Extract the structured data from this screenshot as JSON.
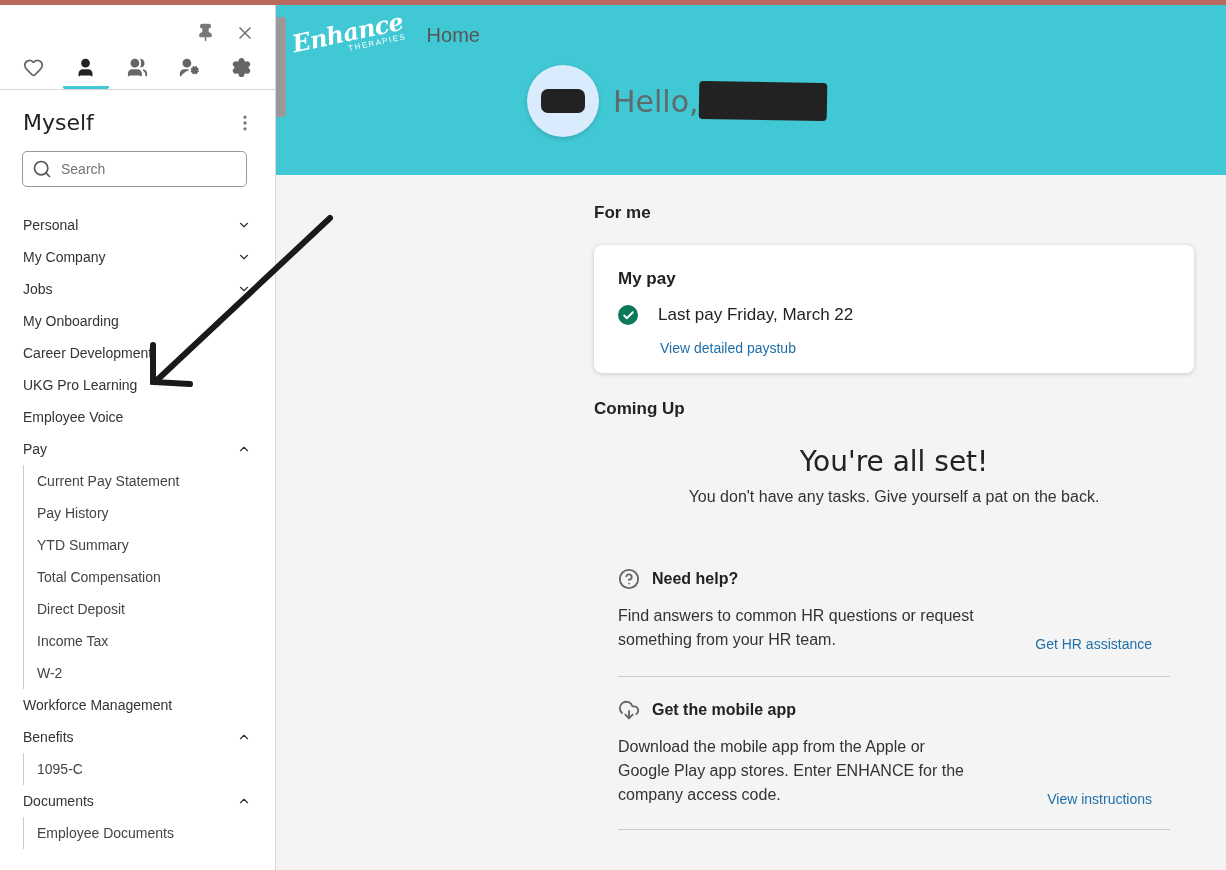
{
  "sidebar": {
    "tabs": [
      {
        "selected": false
      },
      {
        "selected": true
      },
      {
        "selected": false
      },
      {
        "selected": false
      },
      {
        "selected": false
      }
    ],
    "title": "Myself",
    "search": {
      "placeholder": "Search"
    },
    "items": [
      {
        "label": "Personal",
        "expanded": false
      },
      {
        "label": "My Company",
        "expanded": false
      },
      {
        "label": "Jobs",
        "expanded": false
      },
      {
        "label": "My Onboarding"
      },
      {
        "label": "Career Development"
      },
      {
        "label": "UKG Pro Learning"
      },
      {
        "label": "Employee Voice"
      },
      {
        "label": "Pay",
        "expanded": true,
        "children": [
          {
            "label": "Current Pay Statement"
          },
          {
            "label": "Pay History"
          },
          {
            "label": "YTD Summary"
          },
          {
            "label": "Total Compensation"
          },
          {
            "label": "Direct Deposit"
          },
          {
            "label": "Income Tax"
          },
          {
            "label": "W-2"
          }
        ]
      },
      {
        "label": "Workforce Management"
      },
      {
        "label": "Benefits",
        "expanded": true,
        "children": [
          {
            "label": "1095-C"
          }
        ]
      },
      {
        "label": "Documents",
        "expanded": true,
        "children": [
          {
            "label": "Employee Documents"
          }
        ]
      }
    ]
  },
  "header": {
    "logo": "Enhance",
    "logo_sub": "THERAPIES",
    "page_title": "Home",
    "greeting": "Hello,"
  },
  "for_me": {
    "heading": "For me",
    "card": {
      "title": "My pay",
      "status": "Last pay Friday, March 22",
      "link": "View detailed paystub"
    }
  },
  "coming_up": {
    "heading": "Coming Up",
    "title": "You're all set!",
    "message": "You don't have any tasks. Give yourself a pat on the back."
  },
  "sections": [
    {
      "kind": "help",
      "title": "Need help?",
      "text": "Find answers to common HR questions or request something from your HR team.",
      "link": "Get HR assistance"
    },
    {
      "kind": "download",
      "title": "Get the mobile app",
      "text": "Download the mobile app from the Apple or Google Play app stores. Enter ENHANCE for the company access code.",
      "link": "View instructions"
    }
  ]
}
